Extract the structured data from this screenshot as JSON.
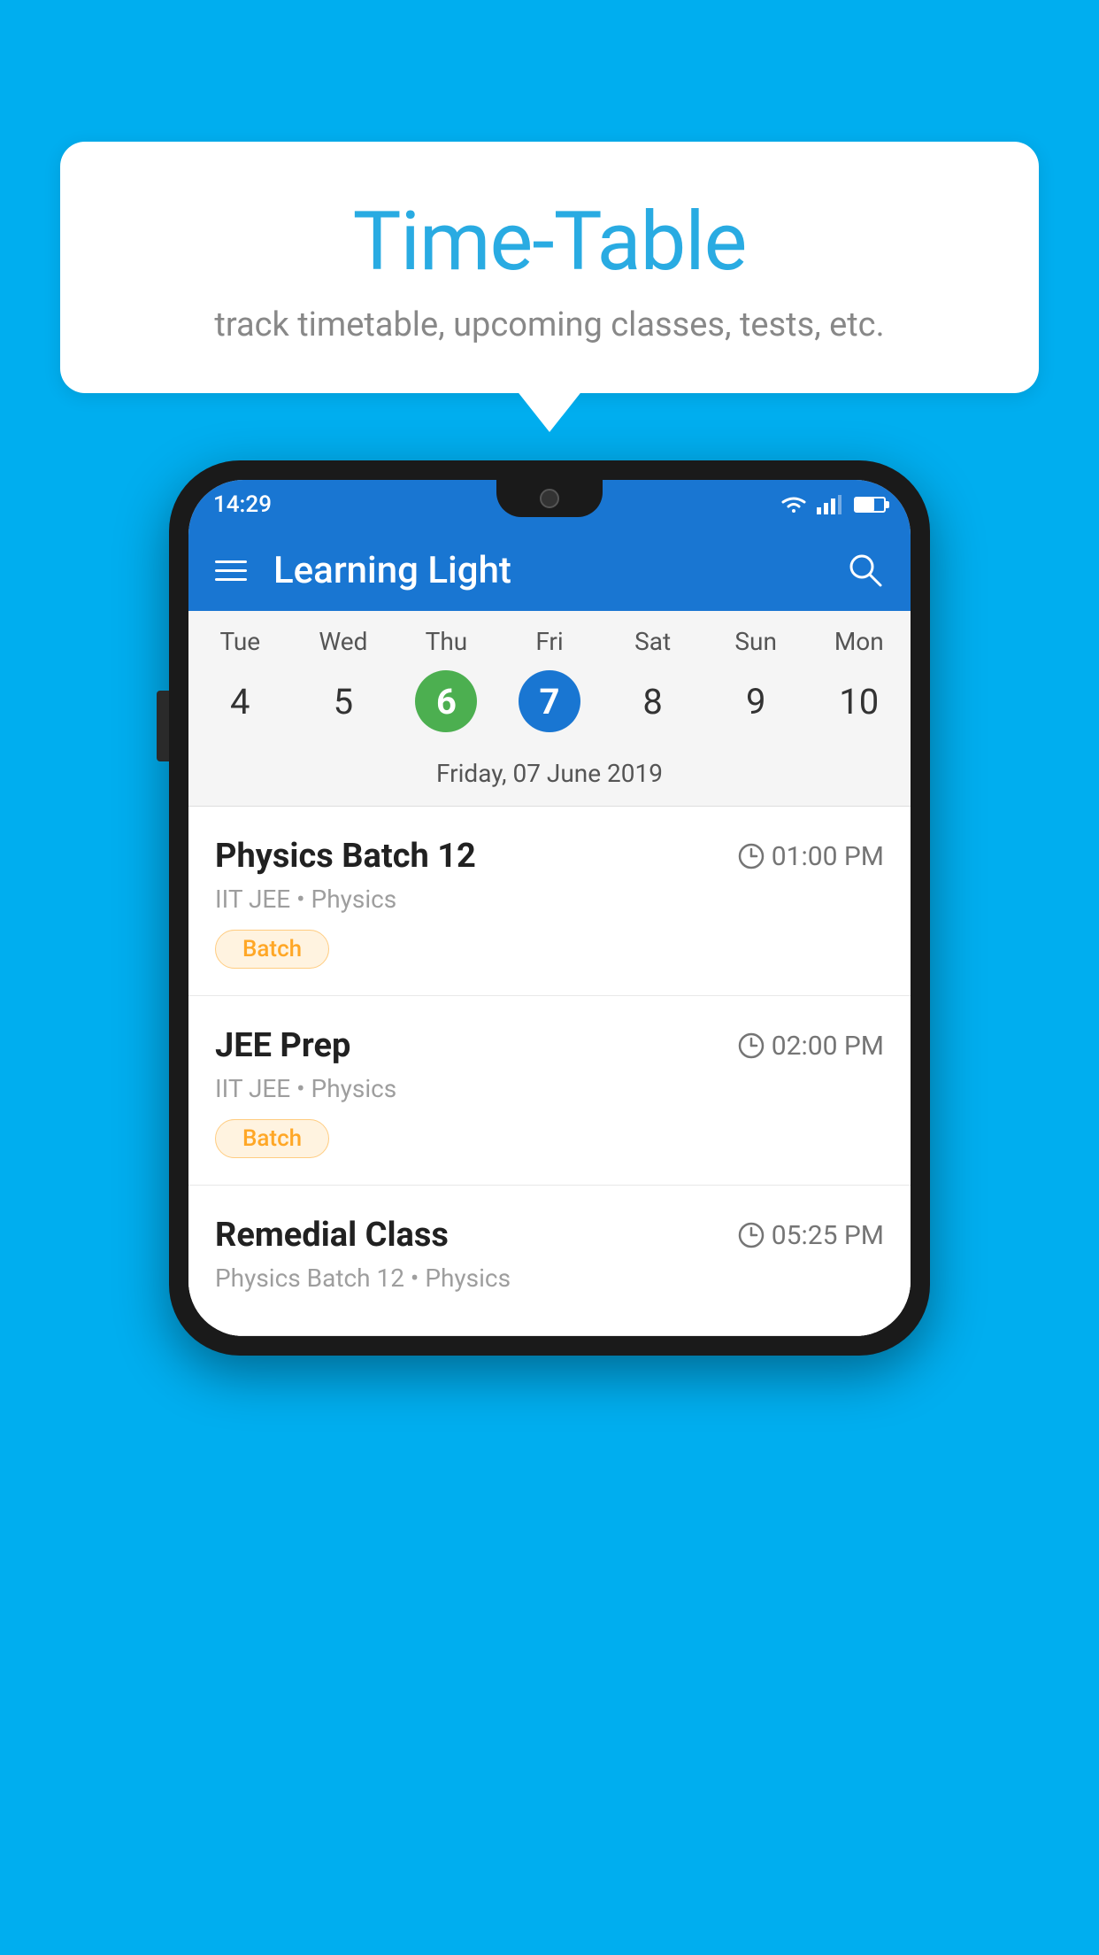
{
  "background_color": "#00AEEF",
  "speech_bubble": {
    "title": "Time-Table",
    "subtitle": "track timetable, upcoming classes, tests, etc."
  },
  "status_bar": {
    "time": "14:29"
  },
  "app_bar": {
    "title": "Learning Light"
  },
  "calendar": {
    "days": [
      {
        "name": "Tue",
        "number": "4",
        "state": "normal"
      },
      {
        "name": "Wed",
        "number": "5",
        "state": "normal"
      },
      {
        "name": "Thu",
        "number": "6",
        "state": "today"
      },
      {
        "name": "Fri",
        "number": "7",
        "state": "selected"
      },
      {
        "name": "Sat",
        "number": "8",
        "state": "normal"
      },
      {
        "name": "Sun",
        "number": "9",
        "state": "normal"
      },
      {
        "name": "Mon",
        "number": "10",
        "state": "normal"
      }
    ],
    "selected_date_label": "Friday, 07 June 2019"
  },
  "classes": [
    {
      "name": "Physics Batch 12",
      "time": "01:00 PM",
      "subtitle": "IIT JEE • Physics",
      "badge": "Batch"
    },
    {
      "name": "JEE Prep",
      "time": "02:00 PM",
      "subtitle": "IIT JEE • Physics",
      "badge": "Batch"
    },
    {
      "name": "Remedial Class",
      "time": "05:25 PM",
      "subtitle": "Physics Batch 12 • Physics",
      "badge": null
    }
  ],
  "icons": {
    "hamburger": "hamburger-menu-icon",
    "search": "search-icon",
    "clock": "clock-icon"
  }
}
